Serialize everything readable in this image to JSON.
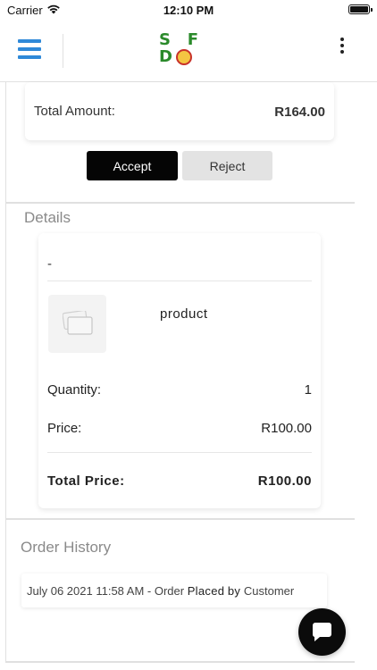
{
  "status_bar": {
    "carrier": "Carrier",
    "time": "12:10 PM",
    "icons": [
      "wifi-icon",
      "battery-icon"
    ]
  },
  "header": {
    "logo_text_top": [
      "S",
      "F"
    ],
    "logo_text_bottom": "D",
    "icons": [
      "menu-icon",
      "more-vertical-icon"
    ]
  },
  "summary": {
    "total_amount_label": "Total Amount:",
    "total_amount_value": "R164.00"
  },
  "actions": {
    "accept_label": "Accept",
    "reject_label": "Reject"
  },
  "details": {
    "title": "Details",
    "dash": "-",
    "product_name": "product",
    "quantity_label": "Quantity:",
    "quantity_value": "1",
    "price_label": "Price:",
    "price_value": "R100.00",
    "total_price_label": "Total Price:",
    "total_price_value": "R100.00"
  },
  "order_history": {
    "title": "Order History",
    "entries": [
      {
        "date_time": "July 06 2021 11:58 AM - Order",
        "status": "Placed",
        "by": "by",
        "actor": "Customer"
      }
    ]
  },
  "colors": {
    "menu_blue": "#2f89d8",
    "logo_green": "#2b8a2b",
    "accept_bg": "#050505",
    "reject_bg": "#e3e3e3",
    "section_title_gray": "#8a8a8a"
  }
}
